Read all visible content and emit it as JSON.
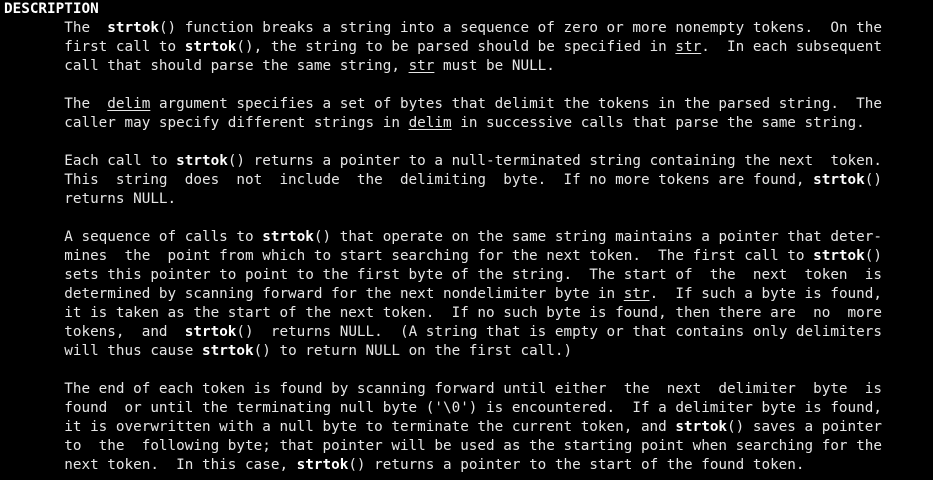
{
  "section": {
    "heading": "DESCRIPTION"
  },
  "paragraphs": [
    {
      "lines": [
        [
          {
            "t": "       The  "
          },
          {
            "t": "strtok",
            "s": "b"
          },
          {
            "t": "() function breaks a string into a sequence of zero or more nonempty tokens.  On the"
          }
        ],
        [
          {
            "t": "       first call to "
          },
          {
            "t": "strtok",
            "s": "b"
          },
          {
            "t": "(), the string to be parsed should be specified in "
          },
          {
            "t": "str",
            "s": "u"
          },
          {
            "t": ".  In each subsequent"
          }
        ],
        [
          {
            "t": "       call that should parse the same string, "
          },
          {
            "t": "str",
            "s": "u"
          },
          {
            "t": " must be NULL."
          }
        ]
      ]
    },
    {
      "lines": [
        [
          {
            "t": "       The  "
          },
          {
            "t": "delim",
            "s": "u"
          },
          {
            "t": " argument specifies a set of bytes that delimit the tokens in the parsed string.  The"
          }
        ],
        [
          {
            "t": "       caller may specify different strings in "
          },
          {
            "t": "delim",
            "s": "u"
          },
          {
            "t": " in successive calls that parse the same string."
          }
        ]
      ]
    },
    {
      "lines": [
        [
          {
            "t": "       Each call to "
          },
          {
            "t": "strtok",
            "s": "b"
          },
          {
            "t": "() returns a pointer to a null-terminated string containing the next  token."
          }
        ],
        [
          {
            "t": "       This  string  does  not  include  the  delimiting  byte.  If no more tokens are found, "
          },
          {
            "t": "strtok",
            "s": "b"
          },
          {
            "t": "()"
          }
        ],
        [
          {
            "t": "       returns NULL."
          }
        ]
      ]
    },
    {
      "lines": [
        [
          {
            "t": "       A sequence of calls to "
          },
          {
            "t": "strtok",
            "s": "b"
          },
          {
            "t": "() that operate on the same string maintains a pointer that deter‐"
          }
        ],
        [
          {
            "t": "       mines  the  point from which to start searching for the next token.  The first call to "
          },
          {
            "t": "strtok",
            "s": "b"
          },
          {
            "t": "()"
          }
        ],
        [
          {
            "t": "       sets this pointer to point to the first byte of the string.  The start of  the  next  token  is"
          }
        ],
        [
          {
            "t": "       determined by scanning forward for the next nondelimiter byte in "
          },
          {
            "t": "str",
            "s": "u"
          },
          {
            "t": ".  If such a byte is found,"
          }
        ],
        [
          {
            "t": "       it is taken as the start of the next token.  If no such byte is found, then there are  no  more"
          }
        ],
        [
          {
            "t": "       tokens,  and  "
          },
          {
            "t": "strtok",
            "s": "b"
          },
          {
            "t": "()  returns NULL.  (A string that is empty or that contains only delimiters"
          }
        ],
        [
          {
            "t": "       will thus cause "
          },
          {
            "t": "strtok",
            "s": "b"
          },
          {
            "t": "() to return NULL on the first call.)"
          }
        ]
      ]
    },
    {
      "lines": [
        [
          {
            "t": "       The end of each token is found by scanning forward until either  the  next  delimiter  byte  is"
          }
        ],
        [
          {
            "t": "       found  or until the terminating null byte ('\\0') is encountered.  If a delimiter byte is found,"
          }
        ],
        [
          {
            "t": "       it is overwritten with a null byte to terminate the current token, and "
          },
          {
            "t": "strtok",
            "s": "b"
          },
          {
            "t": "() saves a pointer"
          }
        ],
        [
          {
            "t": "       to  the  following byte; that pointer will be used as the starting point when searching for the"
          }
        ],
        [
          {
            "t": "       next token.  In this case, "
          },
          {
            "t": "strtok",
            "s": "b"
          },
          {
            "t": "() returns a pointer to the start of the found token."
          }
        ]
      ]
    }
  ]
}
